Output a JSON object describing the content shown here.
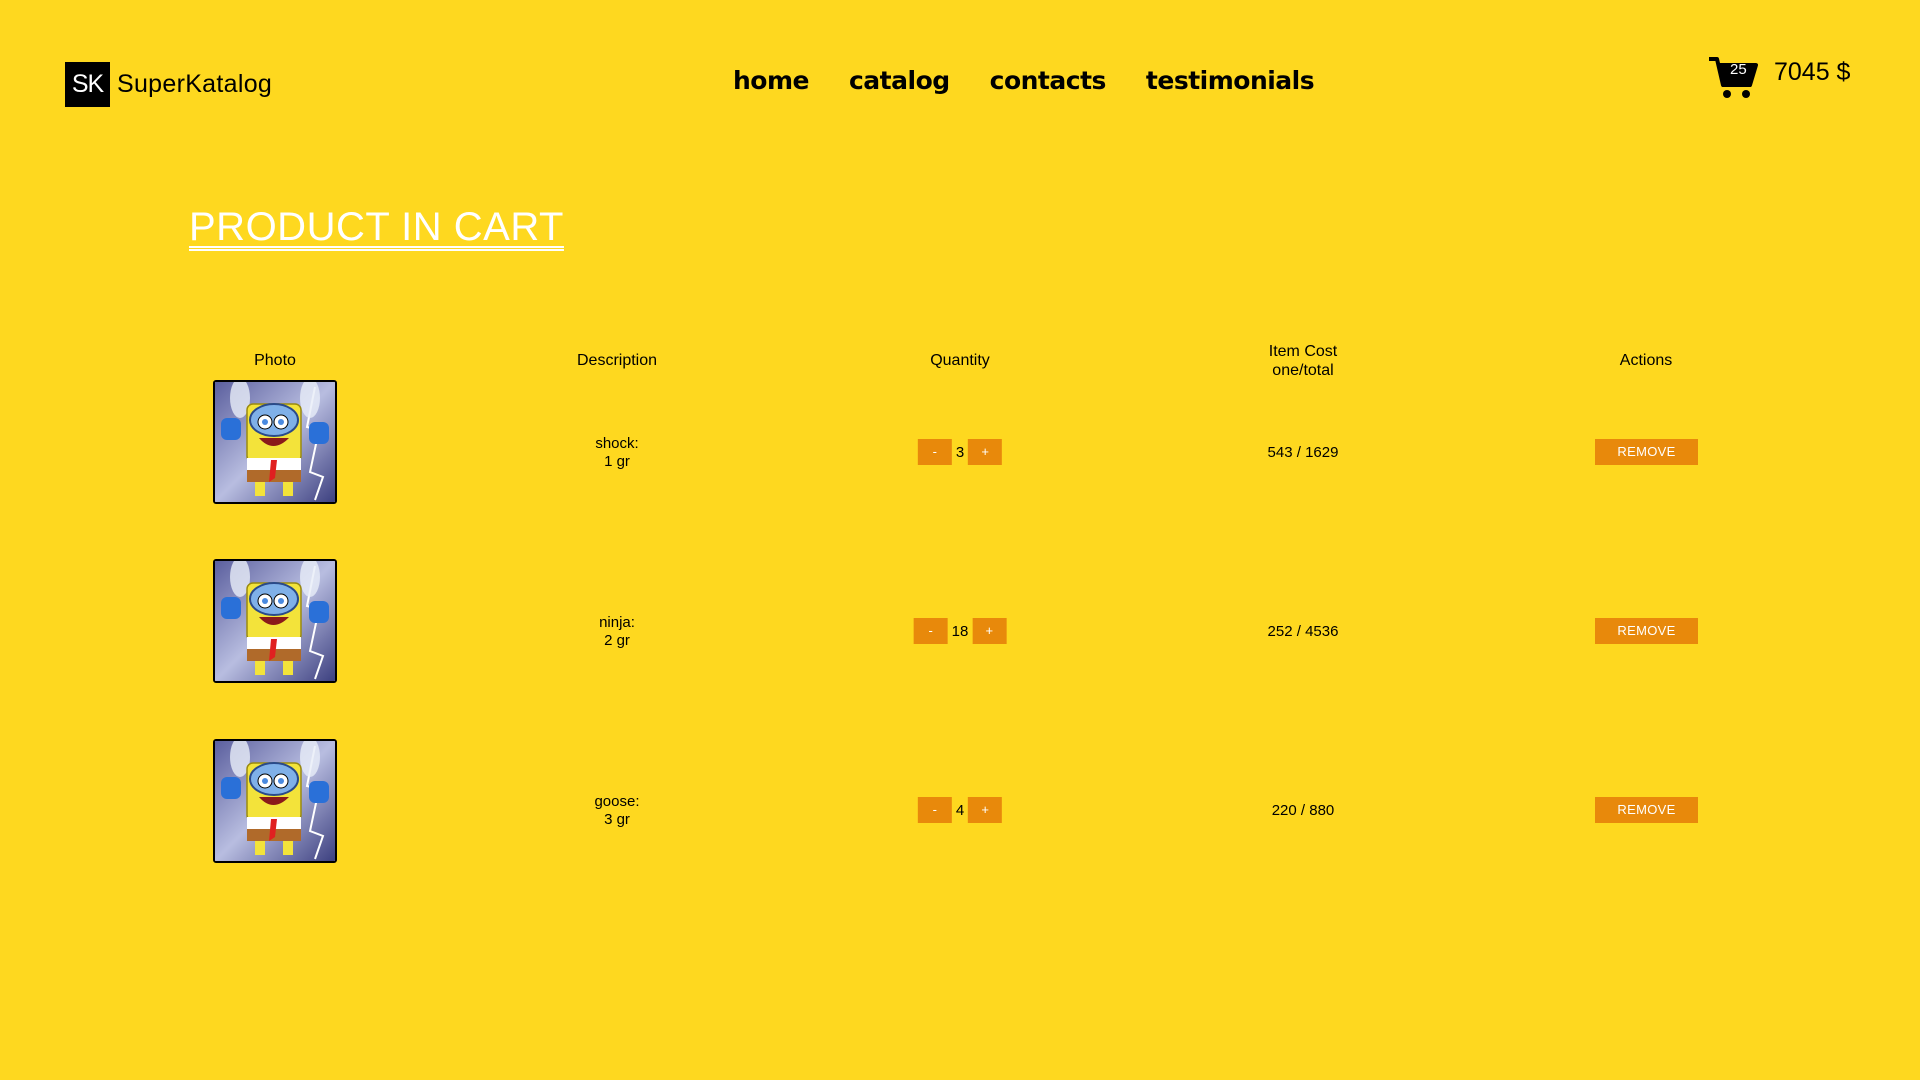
{
  "header": {
    "logo_mark": "SK",
    "logo_text": "SuperKatalog",
    "nav": [
      "home",
      "catalog",
      "contacts",
      "testimonials"
    ],
    "cart_count": "25",
    "cart_total": "7045 $"
  },
  "page_title": "PRODUCT IN CART",
  "table": {
    "headers": {
      "photo": "Photo",
      "description": "Description",
      "quantity": "Quantity",
      "cost_line1": "Item Cost",
      "cost_line2": "one/total",
      "actions": "Actions"
    },
    "rows": [
      {
        "name": "shock:",
        "weight": "1 gr",
        "minus": "-",
        "qty": "3",
        "plus": "+",
        "cost": "543 / 1629",
        "remove": "REMOVE"
      },
      {
        "name": "ninja:",
        "weight": "2 gr",
        "minus": "-",
        "qty": "18",
        "plus": "+",
        "cost": "252 / 4536",
        "remove": "REMOVE"
      },
      {
        "name": "goose:",
        "weight": "3 gr",
        "minus": "-",
        "qty": "4",
        "plus": "+",
        "cost": "220 / 880",
        "remove": "REMOVE"
      }
    ]
  },
  "colors": {
    "background": "#fed81f",
    "accent_button": "#e8890b",
    "title": "#ffffff"
  },
  "icons": {
    "cart": "shopping-cart-icon",
    "product": "product-photo"
  }
}
